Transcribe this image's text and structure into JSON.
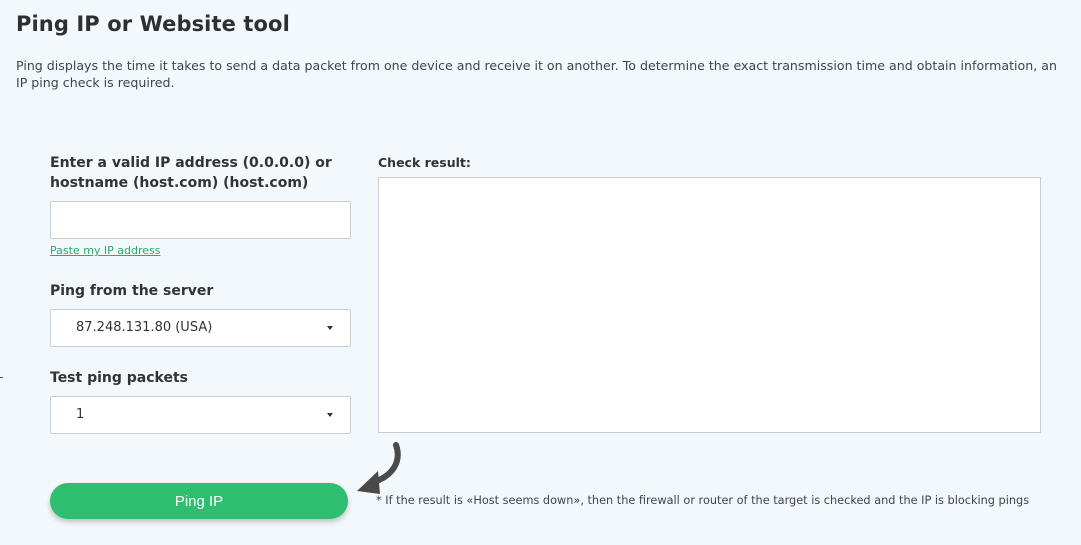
{
  "page": {
    "title": "Ping IP or Website tool",
    "description": "Ping displays the time it takes to send a data packet from one device and receive it on another. To determine the exact transmission time and obtain information, an IP ping check is required."
  },
  "form": {
    "ip_label": "Enter a valid IP address (0.0.0.0) or hostname (host.com) (host.com)",
    "ip_value": "",
    "paste_link": "Paste my IP address",
    "server_label": "Ping from the server",
    "server_value": "87.248.131.80 (USA)",
    "packets_label": "Test ping packets",
    "packets_value": "1",
    "ping_button": "Ping IP"
  },
  "result": {
    "label": "Check result:",
    "content": ""
  },
  "note": "* If the result is «Host seems down», then the firewall or router of the target is checked and the IP is blocking pings",
  "icons": {
    "arrow": "curved-arrow-icon",
    "dropdown": "caret-down-icon"
  },
  "colors": {
    "accent": "#2fbd6f",
    "link": "#2ea86b",
    "background": "#f3f8fc"
  }
}
